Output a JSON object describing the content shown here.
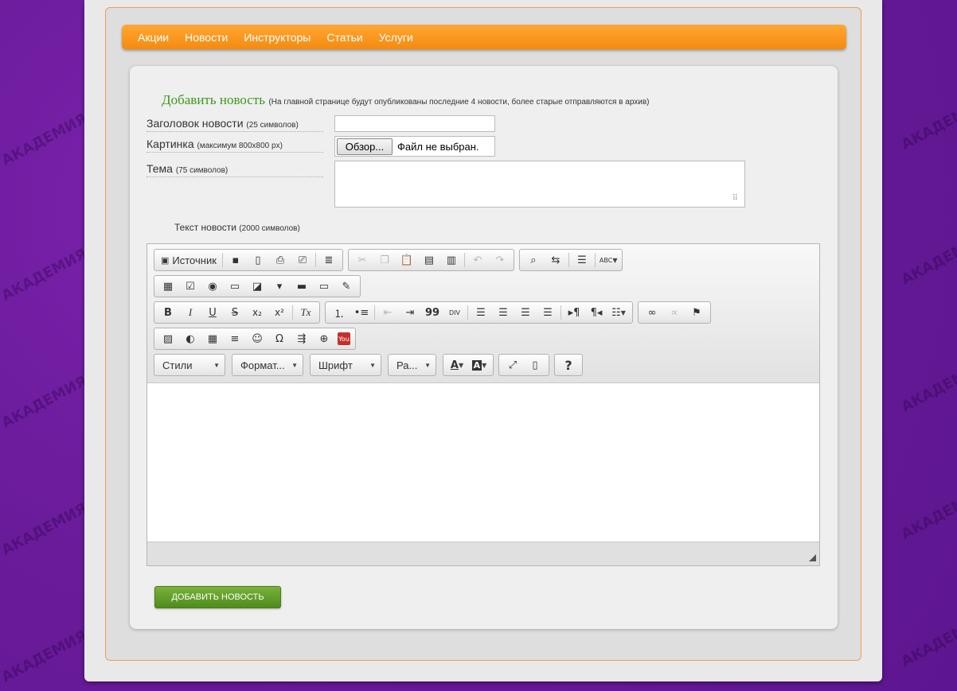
{
  "background_logo_text": "АКАДЕМИЯ ЗДОРОВЬЯ",
  "nav": {
    "items": [
      "Акции",
      "Новости",
      "Инструкторы",
      "Статьи",
      "Услуги"
    ]
  },
  "form": {
    "title": "Добавить новость",
    "title_note": "(На главной странице будут опубликованы последние 4 новости, более старые отправляются в архив)",
    "headline_label": "Заголовок новости",
    "headline_hint": "(25 символов)",
    "headline_value": "",
    "image_label": "Картинка",
    "image_hint": "(максимум 800x800 px)",
    "file_button": "Обзор...",
    "file_status": "Файл не выбран.",
    "theme_label": "Тема",
    "theme_hint": "(75 символов)",
    "theme_value": "",
    "text_label": "Текст новости",
    "text_hint": "(2000 символов)",
    "submit_label": "ДОБАВИТЬ НОВОСТЬ"
  },
  "editor": {
    "source_label": "Источник",
    "styles_label": "Стили",
    "format_label": "Формат...",
    "font_label": "Шрифт",
    "size_label": "Ра...",
    "help_label": "?",
    "bold": "B",
    "italic": "I",
    "underline": "U",
    "strike": "S",
    "subscript": "x₂",
    "superscript": "x²",
    "remove_format": "Tx",
    "blockquote": "99",
    "div": "DIV",
    "spellcheck": "ABC",
    "omega": "Ω",
    "youtube": "You"
  },
  "colors": {
    "accent_orange": "#f58a10",
    "title_green": "#3a9a1a",
    "button_green": "#5a9a24",
    "background_purple": "#6a1b9a"
  }
}
